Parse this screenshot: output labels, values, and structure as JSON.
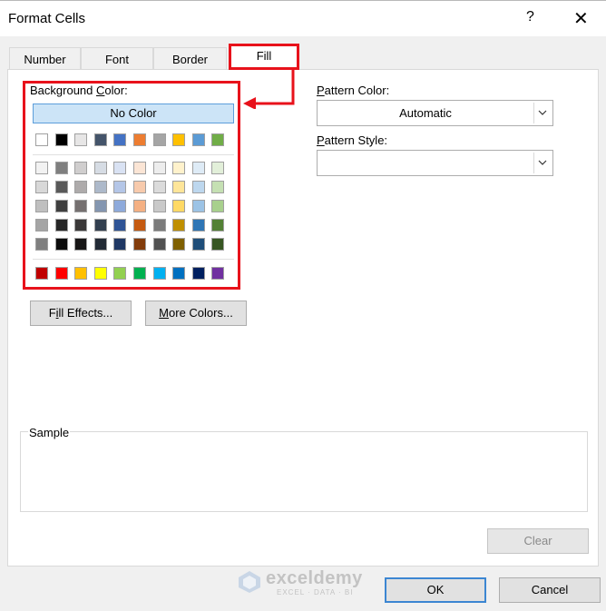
{
  "dialog": {
    "title": "Format Cells",
    "help": "?",
    "close": "✕"
  },
  "tabs": [
    {
      "label": "Number"
    },
    {
      "label": "Font"
    },
    {
      "label": "Border"
    },
    {
      "label": "Fill"
    }
  ],
  "fill": {
    "background_color_label": "Background Color:",
    "no_color_label": "No Color",
    "fill_effects_label": "Fill Effects...",
    "more_colors_label": "More Colors...",
    "pattern_color_label": "Pattern Color:",
    "pattern_color_value": "Automatic",
    "pattern_style_label": "Pattern Style:",
    "pattern_style_value": "",
    "sample_label": "Sample",
    "clear_label": "Clear"
  },
  "palette": {
    "top_row": [
      "#ffffff",
      "#000000",
      "#e7e6e6",
      "#44546a",
      "#4472c4",
      "#ed7d31",
      "#a5a5a5",
      "#ffc000",
      "#5b9bd5",
      "#70ad47"
    ],
    "shade_rows": [
      [
        "#f2f2f2",
        "#7f7f7f",
        "#d0cece",
        "#d6dce4",
        "#d9e2f3",
        "#fbe5d5",
        "#ededed",
        "#fff2cc",
        "#deebf6",
        "#e2efd9"
      ],
      [
        "#d8d8d8",
        "#595959",
        "#aeabab",
        "#adb9ca",
        "#b4c6e7",
        "#f7caac",
        "#dbdbdb",
        "#fee599",
        "#bdd7ee",
        "#c5e0b3"
      ],
      [
        "#bfbfbf",
        "#3f3f3f",
        "#757070",
        "#8496b0",
        "#8eaadb",
        "#f4b083",
        "#c9c9c9",
        "#ffd965",
        "#9cc3e5",
        "#a8d08d"
      ],
      [
        "#a5a5a5",
        "#262626",
        "#3a3838",
        "#323f4f",
        "#2f5496",
        "#c55a11",
        "#7b7b7b",
        "#bf8f00",
        "#2e75b5",
        "#538135"
      ],
      [
        "#7f7f7f",
        "#0c0c0c",
        "#171616",
        "#222a35",
        "#1f3864",
        "#833c0b",
        "#525252",
        "#7f6000",
        "#1f4e79",
        "#375623"
      ]
    ],
    "standard_row": [
      "#c00000",
      "#ff0000",
      "#ffc000",
      "#ffff00",
      "#92d050",
      "#00b050",
      "#00b0f0",
      "#0070c0",
      "#002060",
      "#7030a0"
    ]
  },
  "footer": {
    "ok_label": "OK",
    "cancel_label": "Cancel"
  },
  "watermark": {
    "name": "exceldemy",
    "tagline": "EXCEL · DATA · BI"
  },
  "colors": {
    "highlight_red": "#e8121b",
    "no_color_bg": "#cce4f7",
    "ok_border": "#3c86d2"
  }
}
